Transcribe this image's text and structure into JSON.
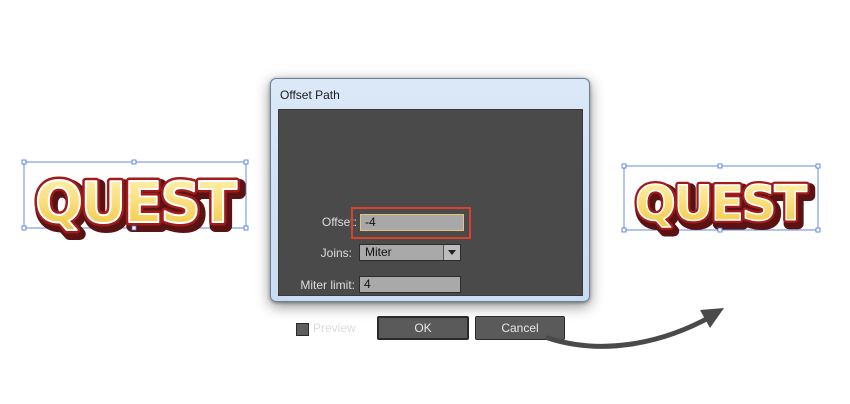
{
  "dialog": {
    "title": "Offset Path",
    "offset_label": "Offset:",
    "offset_value": "-4",
    "joins_label": "Joins:",
    "joins_value": "Miter",
    "miter_limit_label": "Miter limit:",
    "miter_limit_value": "4",
    "preview_label": "Preview",
    "preview_checked": false,
    "ok_label": "OK",
    "cancel_label": "Cancel"
  },
  "artwork": {
    "word": "QUEST",
    "colors": {
      "outline_dark": "#5a1212",
      "outline_red": "#a11b1b",
      "shadow_brown": "#7a1f14",
      "fill_light": "#fff6b8",
      "fill_dark": "#f2c43a",
      "selection_blue": "#3f6fe0",
      "highlight_red": "#d9432e"
    }
  }
}
